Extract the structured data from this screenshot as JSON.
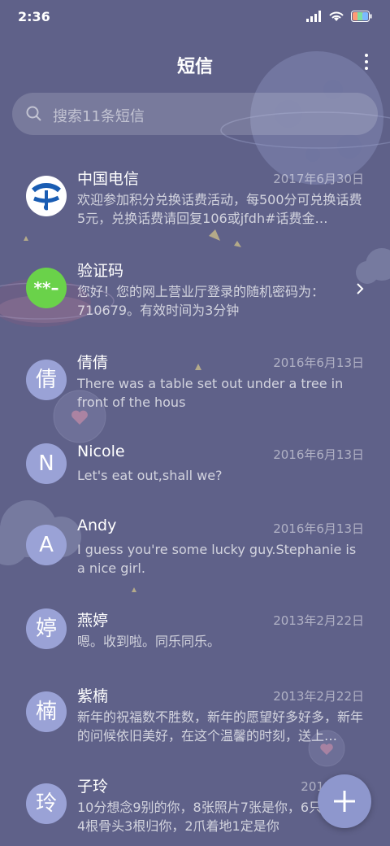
{
  "status_bar": {
    "time": "2:36"
  },
  "header": {
    "title": "短信"
  },
  "search": {
    "placeholder": "搜索11条短信"
  },
  "colors": {
    "background": "#5f6189",
    "avatar": "#9aa2d6",
    "accent_green": "#6ad24a",
    "telecom_blue": "#1a5db3",
    "fab": "#8e97cd"
  },
  "conversations": [
    {
      "name": "中国电信",
      "date": "2017年6月30日",
      "preview": "欢迎参加积分兑换话费活动，每500分可兑换话费5元，兑换话费请回复106或jfdh#话费金…",
      "avatar_icon": "china-telecom-logo"
    },
    {
      "name": "验证码",
      "date": "",
      "preview": "您好！您的网上营业厅登录的随机密码为：710679。有效时间为3分钟",
      "avatar_text": "**–"
    },
    {
      "name": "倩倩",
      "date": "2016年6月13日",
      "preview": "There was a table set out under a tree in front of the hous",
      "avatar_text": "倩"
    },
    {
      "name": "Nicole",
      "date": "2016年6月13日",
      "preview": "Let's eat out,shall we?",
      "avatar_text": "N"
    },
    {
      "name": "Andy",
      "date": "2016年6月13日",
      "preview": "I guess you're some lucky guy.Stephanie is a nice girl.",
      "avatar_text": "A"
    },
    {
      "name": "燕婷",
      "date": "2013年2月22日",
      "preview": "嗯。收到啦。同乐同乐。",
      "avatar_text": "婷"
    },
    {
      "name": "紫楠",
      "date": "2013年2月22日",
      "preview": "新年的祝福数不胜数，新年的愿望好多好多，新年的问候依旧美好，在这个温馨的时刻，送上…",
      "avatar_text": "楠"
    },
    {
      "name": "子玲",
      "date": "2013年2月",
      "preview": "10分想念9别的你，8张照片7张是你，6只像你，4根骨头3根归你，2爪着地1定是你",
      "avatar_text": "玲"
    }
  ]
}
